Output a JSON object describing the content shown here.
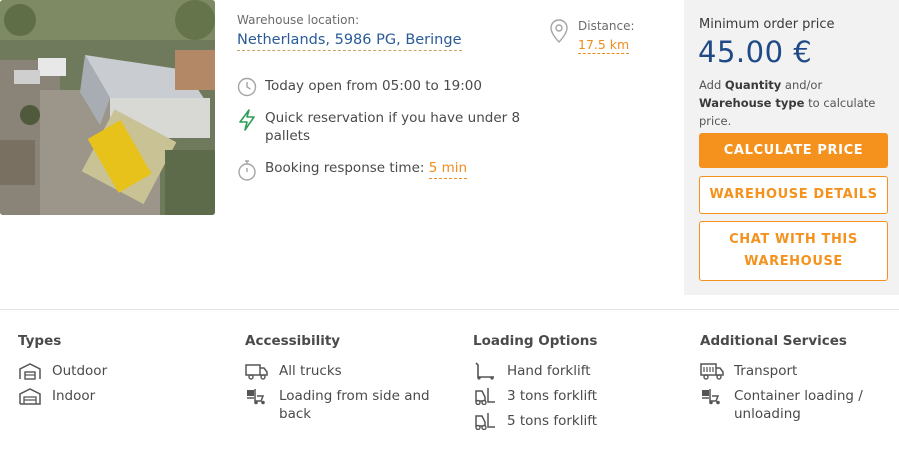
{
  "warehouse": {
    "location_label": "Warehouse location:",
    "location_value": "Netherlands, 5986 PG, Beringe",
    "hours": "Today open from 05:00 to 19:00",
    "quick_reservation": "Quick reservation if you have under 8 pallets",
    "booking_label": "Booking response time:",
    "booking_value": "5 min",
    "distance_label": "Distance:",
    "distance_value": "17.5 km"
  },
  "pricing": {
    "min_label": "Minimum order price",
    "price": "45.00 €",
    "hint_pre": "Add ",
    "hint_qty": "Quantity",
    "hint_mid": " and/or ",
    "hint_type": "Warehouse type",
    "hint_post": " to calculate price.",
    "calc_button": "CALCULATE PRICE",
    "details_button": "WAREHOUSE DETAILS",
    "chat_button": "CHAT WITH THIS WAREHOUSE"
  },
  "features": {
    "types": {
      "title": "Types",
      "items": [
        "Outdoor",
        "Indoor"
      ]
    },
    "accessibility": {
      "title": "Accessibility",
      "items": [
        "All trucks",
        "Loading from side and back"
      ]
    },
    "loading": {
      "title": "Loading Options",
      "items": [
        "Hand forklift",
        "3 tons forklift",
        "5 tons forklift"
      ]
    },
    "services": {
      "title": "Additional Services",
      "items": [
        "Transport",
        "Container loading / unloading"
      ]
    }
  },
  "colors": {
    "accent": "#f4921d",
    "brand": "#1f4a86",
    "link": "#2a5b97",
    "quick_icon": "#2e9e58"
  },
  "icons": {
    "hours": "clock-icon",
    "quick": "lightning-icon",
    "booking": "stopwatch-icon",
    "distance": "map-pin-icon",
    "outdoor": "outdoor-warehouse-icon",
    "indoor": "indoor-warehouse-icon",
    "all_trucks": "truck-icon",
    "side_back": "forklift-loading-icon",
    "hand_forklift": "hand-forklift-icon",
    "forklift": "forklift-icon",
    "transport": "transport-truck-icon",
    "container": "container-loading-icon"
  }
}
